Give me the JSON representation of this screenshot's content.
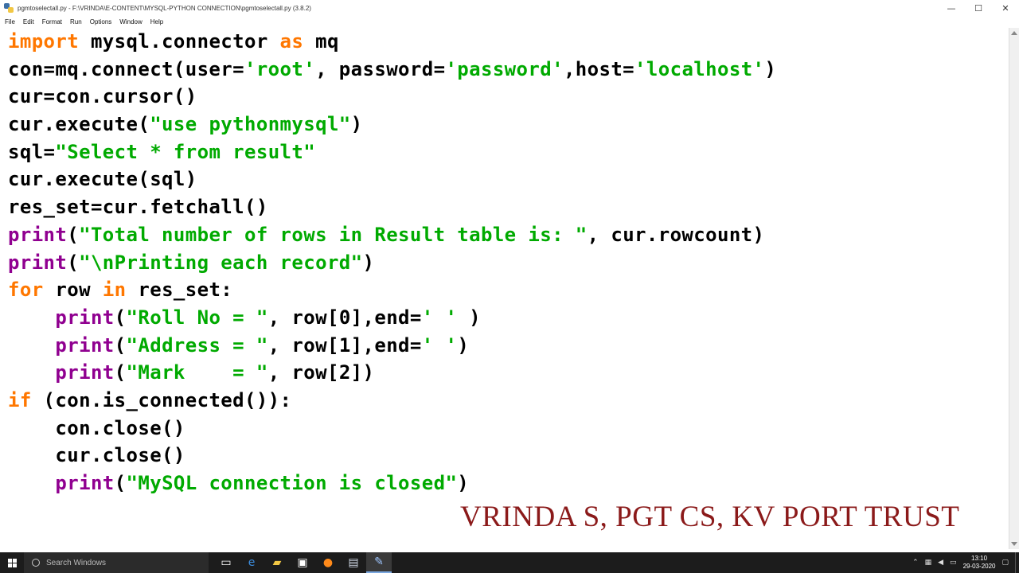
{
  "window": {
    "title": "pgmtoselectall.py - F:\\VRINDA\\E-CONTENT\\MYSQL-PYTHON CONNECTION\\pgmtoselectall.py (3.8.2)",
    "minimize": "—",
    "maximize": "☐",
    "close": "✕"
  },
  "menu": [
    "File",
    "Edit",
    "Format",
    "Run",
    "Options",
    "Window",
    "Help"
  ],
  "code": {
    "lines": [
      [
        {
          "t": "import",
          "c": "kw"
        },
        {
          "t": " mysql.connector "
        },
        {
          "t": "as",
          "c": "kw"
        },
        {
          "t": " mq"
        }
      ],
      [
        {
          "t": "con=mq.connect(user="
        },
        {
          "t": "'root'",
          "c": "st"
        },
        {
          "t": ", password="
        },
        {
          "t": "'password'",
          "c": "st"
        },
        {
          "t": ",host="
        },
        {
          "t": "'localhost'",
          "c": "st"
        },
        {
          "t": ")"
        }
      ],
      [
        {
          "t": "cur=con.cursor()"
        }
      ],
      [
        {
          "t": "cur.execute("
        },
        {
          "t": "\"use pythonmysql\"",
          "c": "st"
        },
        {
          "t": ")"
        }
      ],
      [
        {
          "t": "sql="
        },
        {
          "t": "\"Select * from result\"",
          "c": "st"
        }
      ],
      [
        {
          "t": "cur.execute(sql)"
        }
      ],
      [
        {
          "t": "res_set=cur.fetchall()"
        }
      ],
      [
        {
          "t": "print",
          "c": "bi"
        },
        {
          "t": "("
        },
        {
          "t": "\"Total number of rows in Result table is: \"",
          "c": "st"
        },
        {
          "t": ", cur.rowcount)"
        }
      ],
      [
        {
          "t": "print",
          "c": "bi"
        },
        {
          "t": "("
        },
        {
          "t": "\"\\nPrinting each record\"",
          "c": "st"
        },
        {
          "t": ")"
        }
      ],
      [
        {
          "t": "for",
          "c": "kw"
        },
        {
          "t": " row "
        },
        {
          "t": "in",
          "c": "kw"
        },
        {
          "t": " res_set:"
        }
      ],
      [
        {
          "t": "    "
        },
        {
          "t": "print",
          "c": "bi"
        },
        {
          "t": "("
        },
        {
          "t": "\"Roll No = \"",
          "c": "st"
        },
        {
          "t": ", row[0],end="
        },
        {
          "t": "' '",
          "c": "st"
        },
        {
          "t": " )"
        }
      ],
      [
        {
          "t": "    "
        },
        {
          "t": "print",
          "c": "bi"
        },
        {
          "t": "("
        },
        {
          "t": "\"Address = \"",
          "c": "st"
        },
        {
          "t": ", row[1],end="
        },
        {
          "t": "' '",
          "c": "st"
        },
        {
          "t": ")"
        }
      ],
      [
        {
          "t": "    "
        },
        {
          "t": "print",
          "c": "bi"
        },
        {
          "t": "("
        },
        {
          "t": "\"Mark    = \"",
          "c": "st"
        },
        {
          "t": ", row[2])"
        }
      ],
      [
        {
          "t": "if",
          "c": "kw"
        },
        {
          "t": " (con.is_connected()):"
        }
      ],
      [
        {
          "t": "    con.close()"
        }
      ],
      [
        {
          "t": "    cur.close()"
        }
      ],
      [
        {
          "t": "    "
        },
        {
          "t": "print",
          "c": "bi"
        },
        {
          "t": "("
        },
        {
          "t": "\"MySQL connection is closed\"",
          "c": "st"
        },
        {
          "t": ")"
        }
      ]
    ]
  },
  "watermark": "VRINDA S, PGT CS, KV PORT TRUST",
  "taskbar": {
    "search_placeholder": "Search Windows",
    "apps": [
      {
        "name": "task-view-icon",
        "glyph": "▭",
        "color": "#ffffff"
      },
      {
        "name": "edge-icon",
        "glyph": "e",
        "color": "#3c8dde"
      },
      {
        "name": "file-explorer-icon",
        "glyph": "▰",
        "color": "#f2c744"
      },
      {
        "name": "store-icon",
        "glyph": "▣",
        "color": "#ffffff"
      },
      {
        "name": "firefox-icon",
        "glyph": "●",
        "color": "#ff8a1a"
      },
      {
        "name": "python-shell-icon",
        "glyph": "▤",
        "color": "#cfd8e6"
      },
      {
        "name": "idle-editor-icon",
        "glyph": "✎",
        "color": "#9ec6ff",
        "active": true
      }
    ],
    "time": "13:10",
    "date": "29-03-2020"
  }
}
